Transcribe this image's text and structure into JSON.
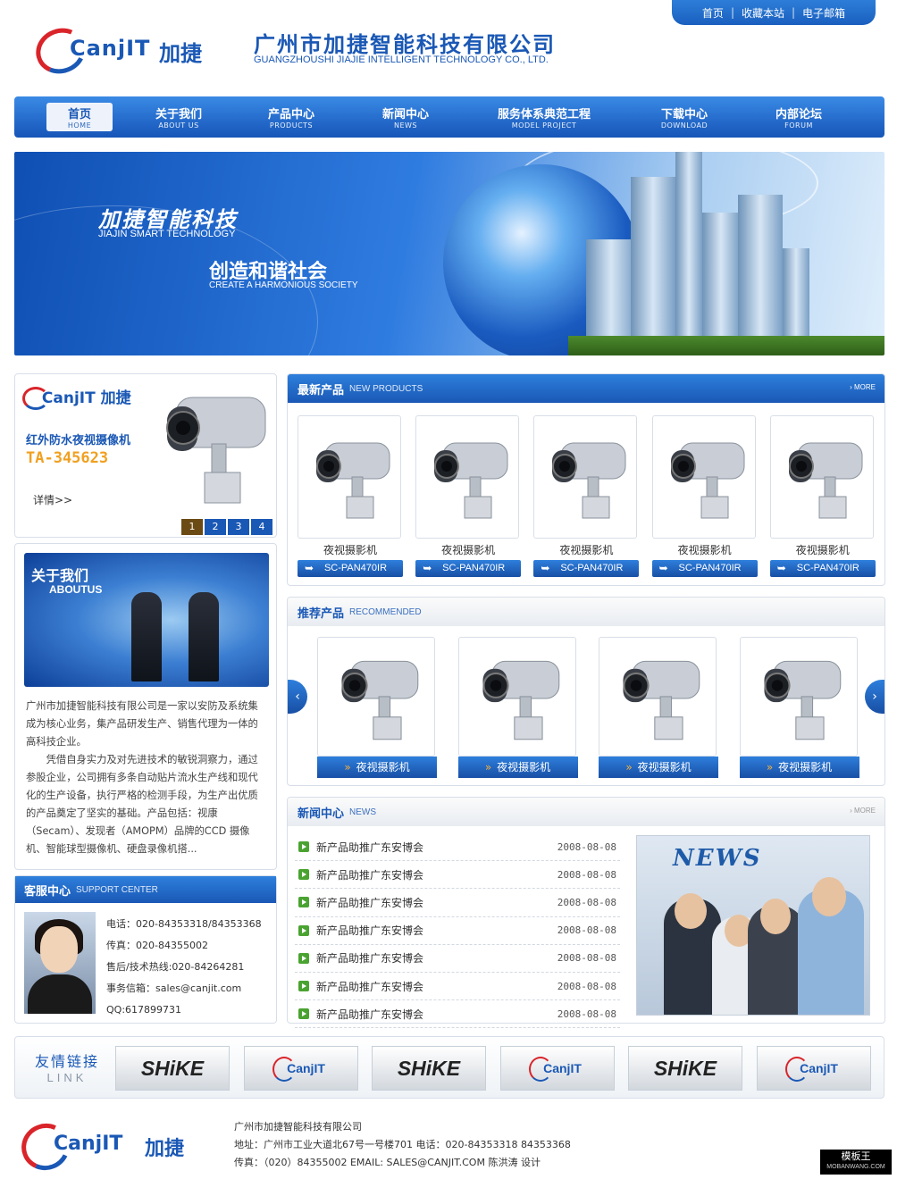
{
  "top_links": [
    "首页",
    "收藏本站",
    "电子邮箱"
  ],
  "header": {
    "logo_latin": "CanjIT",
    "logo_cn": "加捷",
    "company_name": "广州市加捷智能科技有限公司",
    "company_name_en": "GUANGZHOUSHI JIAJIE INTELLIGENT TECHNOLOGY CO., LTD."
  },
  "nav": [
    {
      "cn": "首页",
      "en": "HOME"
    },
    {
      "cn": "关于我们",
      "en": "ABOUT US"
    },
    {
      "cn": "产品中心",
      "en": "PRODUCTS"
    },
    {
      "cn": "新闻中心",
      "en": "NEWS"
    },
    {
      "cn": "服务体系典范工程",
      "en": "MODEL PROJECT"
    },
    {
      "cn": "下载中心",
      "en": "DOWNLOAD"
    },
    {
      "cn": "内部论坛",
      "en": "FORUM"
    }
  ],
  "banner": {
    "title": "加捷智能科技",
    "title_en": "JIAJIN SMART TECHNOLOGY",
    "slogan": "创造和谐社会",
    "slogan_en": "CREATE A HARMONIOUS SOCIETY"
  },
  "promo": {
    "logo_latin": "CanjIT",
    "logo_cn": "加捷",
    "product_name": "红外防水夜视摄像机",
    "model": "TA-345623",
    "more_label": "详情>>",
    "pages": [
      "1",
      "2",
      "3",
      "4"
    ],
    "active_page": 0
  },
  "about": {
    "title": "关于我们",
    "title_en": "ABOUTUS",
    "para1": "广州市加捷智能科技有限公司是一家以安防及系统集成为核心业务，集产品研发生产、销售代理为一体的高科技企业。",
    "para2": "凭借自身实力及对先进技术的敏锐洞察力，通过参股企业，公司拥有多条自动贴片流水生产线和现代化的生产设备，执行严格的检测手段，为生产出优质的产品奠定了坚实的基础。产品包括：视康（Secam）、发现者（AMOPM）品牌的CCD 摄像机、智能球型摄像机、硬盘录像机搭..."
  },
  "support": {
    "title": "客服中心",
    "title_en": "SUPPORT CENTER",
    "lines": [
      "电话：020-84353318/84353368",
      "传真：020-84355002",
      "售后/技术热线:020-84264281",
      "事务信箱：sales@canjit.com",
      "QQ:617899731"
    ]
  },
  "new_products": {
    "title": "最新产品",
    "title_en": "NEW PRODUCTS",
    "more": "MORE",
    "items": [
      {
        "name": "夜视摄影机",
        "model": "SC-PAN470IR"
      },
      {
        "name": "夜视摄影机",
        "model": "SC-PAN470IR"
      },
      {
        "name": "夜视摄影机",
        "model": "SC-PAN470IR"
      },
      {
        "name": "夜视摄影机",
        "model": "SC-PAN470IR"
      },
      {
        "name": "夜视摄影机",
        "model": "SC-PAN470IR"
      }
    ]
  },
  "recommended": {
    "title": "推荐产品",
    "title_en": "RECOMMENDED",
    "items": [
      "夜视摄影机",
      "夜视摄影机",
      "夜视摄影机",
      "夜视摄影机"
    ]
  },
  "news": {
    "title": "新闻中心",
    "title_en": "NEWS",
    "more": "MORE",
    "image_caption": "NEWS",
    "items": [
      {
        "title": "新产品助推广东安博会",
        "date": "2008-08-08"
      },
      {
        "title": "新产品助推广东安博会",
        "date": "2008-08-08"
      },
      {
        "title": "新产品助推广东安博会",
        "date": "2008-08-08"
      },
      {
        "title": "新产品助推广东安博会",
        "date": "2008-08-08"
      },
      {
        "title": "新产品助推广东安博会",
        "date": "2008-08-08"
      },
      {
        "title": "新产品助推广东安博会",
        "date": "2008-08-08"
      },
      {
        "title": "新产品助推广东安博会",
        "date": "2008-08-08"
      }
    ]
  },
  "links": {
    "label_cn": "友情链接",
    "label_en": "LINK",
    "items": [
      "SHiKE",
      "CanjIT",
      "SHiKE",
      "CanjIT",
      "SHiKE",
      "CanjIT"
    ]
  },
  "footer": {
    "logo_latin": "CanjIT",
    "logo_cn": "加捷",
    "line1": "广州市加捷智能科技有限公司",
    "line2": "地址：广州市工业大道北67号一号楼701 电话：020-84353318 84353368",
    "line3": "传真：（020）84355002 EMAIL: SALES@CANJIT.COM   陈洪涛 设计"
  },
  "watermark": {
    "cn": "模板王",
    "en": "MOBANWANG.COM"
  },
  "colors": {
    "brand_blue": "#1a58b5",
    "accent_red": "#d9242a",
    "model_orange": "#f0a020",
    "news_green": "#4aa331"
  }
}
